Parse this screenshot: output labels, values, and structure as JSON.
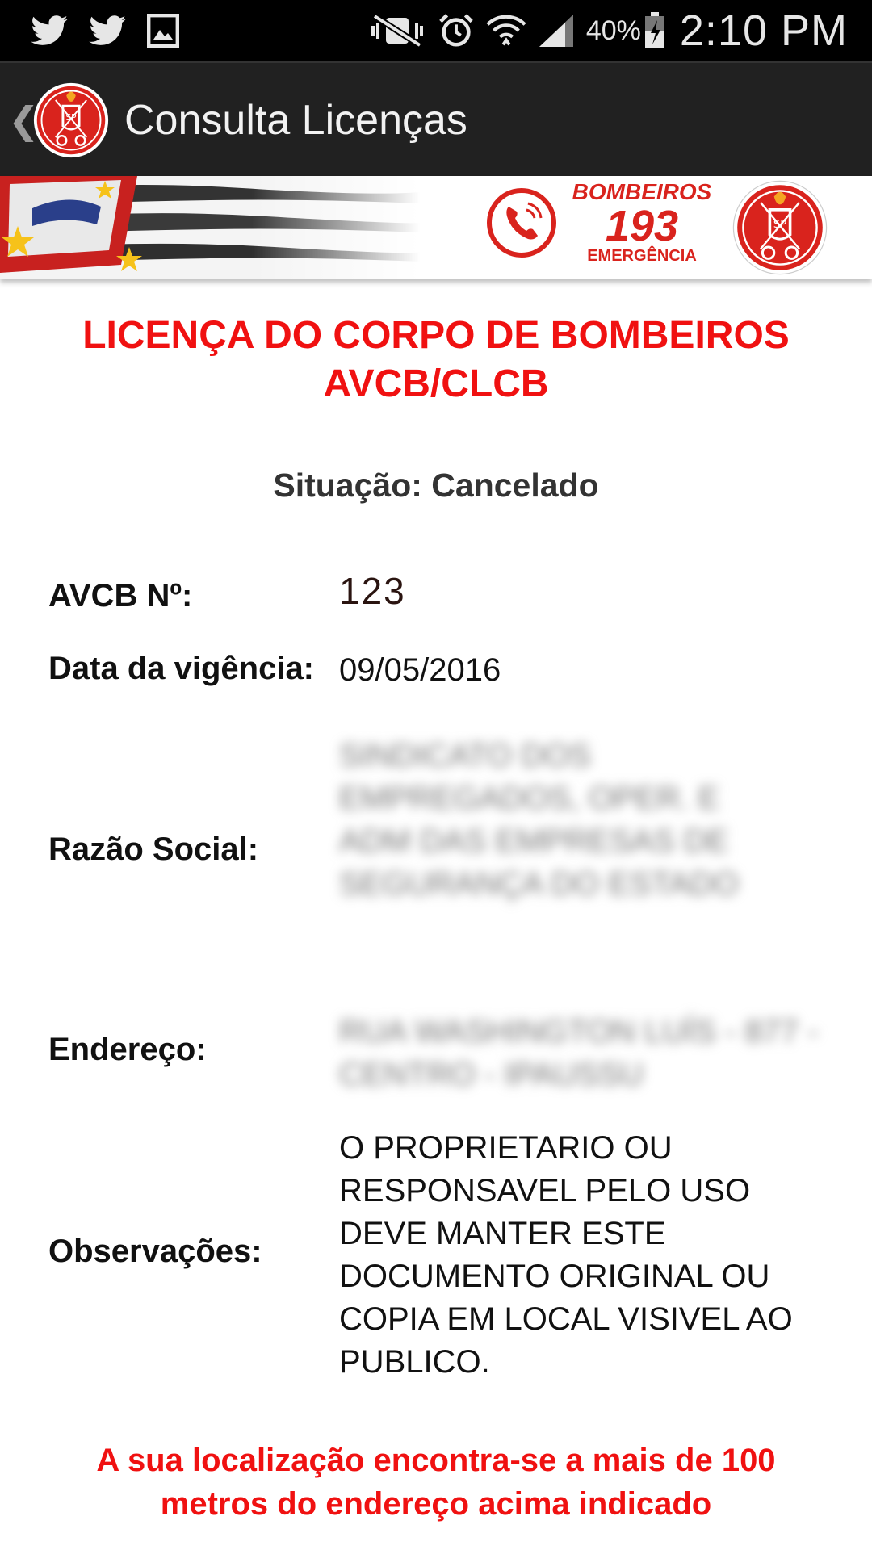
{
  "status_bar": {
    "battery_percent": "40%",
    "time": "2:10 PM",
    "icons": [
      "twitter-icon",
      "twitter-icon",
      "gallery-icon",
      "vibrate-mute-icon",
      "alarm-icon",
      "wifi-icon",
      "signal-icon",
      "battery-charging-icon"
    ]
  },
  "action_bar": {
    "title": "Consulta Licenças",
    "logo": "fire-department-seal-icon"
  },
  "banner": {
    "bombeiros": "BOMBEIROS",
    "number": "193",
    "emergencia": "EMERGÊNCIA"
  },
  "license": {
    "title_line1": "LICENÇA DO CORPO DE BOMBEIROS",
    "title_line2": "AVCB/CLCB",
    "situacao": "Situação: Cancelado",
    "fields": {
      "avcb_label": "AVCB Nº:",
      "avcb_value": "123",
      "data_label": "Data da vigência:",
      "data_value": "09/05/2016",
      "razao_label": "Razão Social:",
      "razao_value": "SINDICATO DOS EMPREGADOS, OPER. E ADM DAS EMPRESAS DE SEGURANÇA DO ESTADO",
      "endereco_label": "Endereço:",
      "endereco_value": "RUA WASHINGTON LUÍS - 877 - CENTRO - IPAUSSU",
      "obs_label": "Observações:",
      "obs_value_lines": [
        "O PROPRIETARIO OU",
        "RESPONSAVEL PELO USO",
        "DEVE MANTER ESTE",
        "DOCUMENTO ORIGINAL OU",
        "COPIA EM LOCAL VISIVEL AO",
        "PUBLICO."
      ]
    },
    "warning_line1": "A sua localização encontra-se a mais de 100",
    "warning_line2": "metros do endereço acima indicado"
  },
  "colors": {
    "accent_red": "#f01111",
    "action_bar": "#212121",
    "status_bar": "#000000"
  }
}
